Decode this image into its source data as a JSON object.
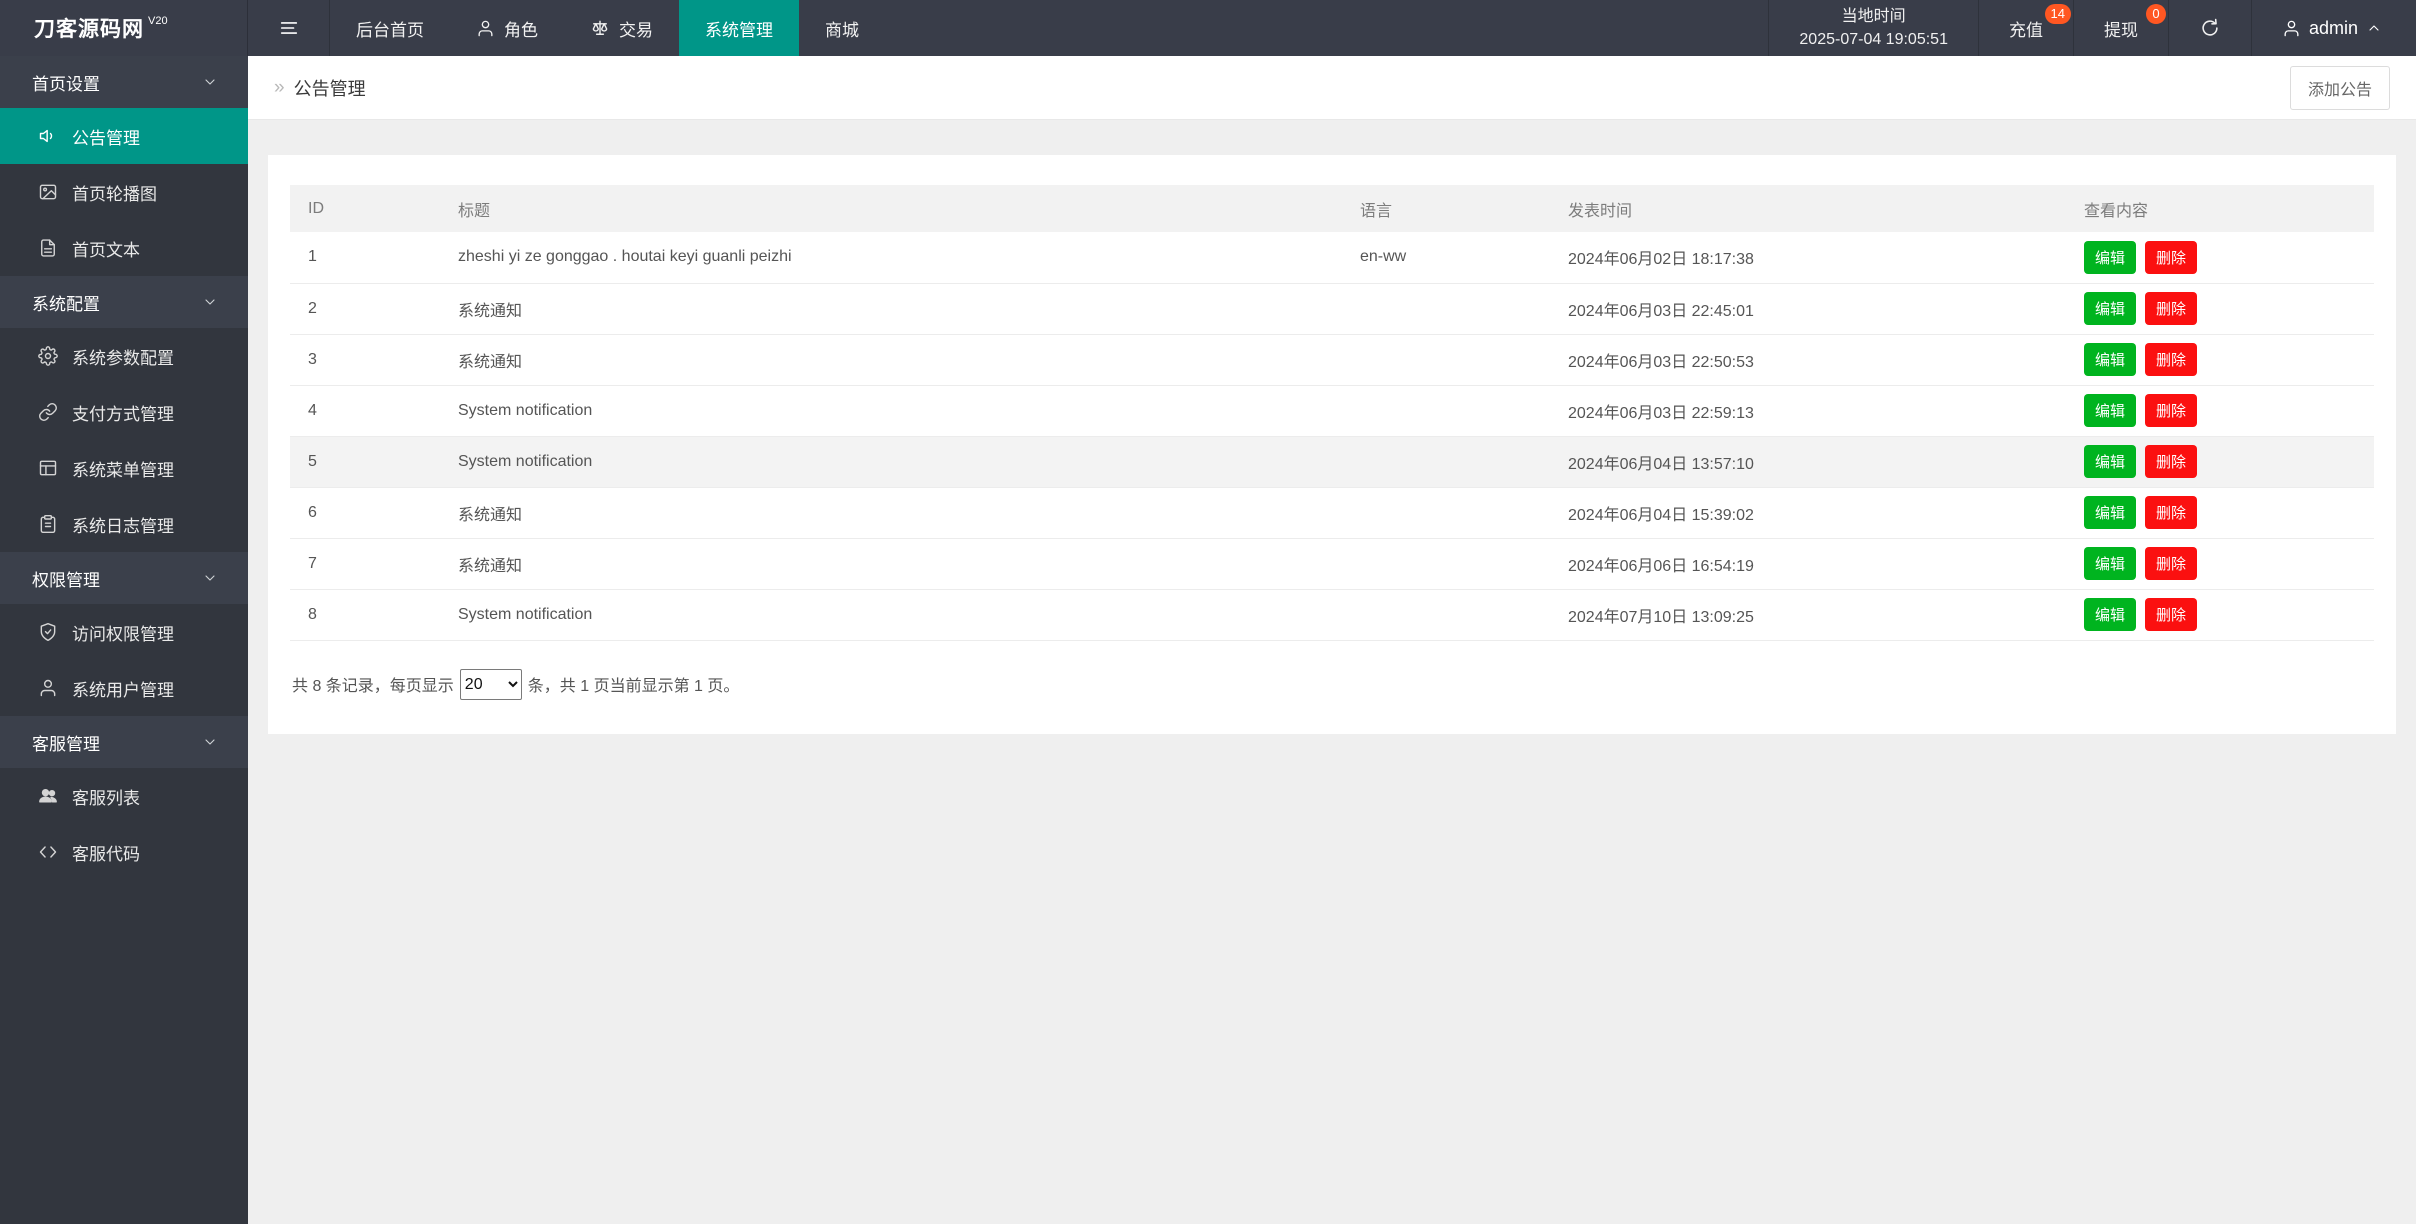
{
  "navbar": {
    "logo": "刀客源码网",
    "version": "V20",
    "items": [
      {
        "label": "后台首页"
      },
      {
        "label": "角色"
      },
      {
        "label": "交易"
      },
      {
        "label": "系统管理"
      },
      {
        "label": "商城"
      }
    ],
    "clock": {
      "label": "当地时间",
      "time": "2025-07-04 19:05:51"
    },
    "recharge": {
      "label": "充值",
      "badge": "14"
    },
    "withdraw": {
      "label": "提现",
      "badge": "0"
    },
    "username": "admin"
  },
  "sidebar": {
    "sections": [
      {
        "title": "首页设置",
        "items": [
          {
            "label": "公告管理"
          },
          {
            "label": "首页轮播图"
          },
          {
            "label": "首页文本"
          }
        ]
      },
      {
        "title": "系统配置",
        "items": [
          {
            "label": "系统参数配置"
          },
          {
            "label": "支付方式管理"
          },
          {
            "label": "系统菜单管理"
          },
          {
            "label": "系统日志管理"
          }
        ]
      },
      {
        "title": "权限管理",
        "items": [
          {
            "label": "访问权限管理"
          },
          {
            "label": "系统用户管理"
          }
        ]
      },
      {
        "title": "客服管理",
        "items": [
          {
            "label": "客服列表"
          },
          {
            "label": "客服代码"
          }
        ]
      }
    ]
  },
  "breadcrumb": {
    "separator": "»",
    "title": "公告管理"
  },
  "toolbar": {
    "add_label": "添加公告"
  },
  "table": {
    "headers": [
      "ID",
      "标题",
      "语言",
      "发表时间",
      "查看内容"
    ],
    "edit_label": "编辑",
    "delete_label": "删除",
    "rows": [
      {
        "id": "1",
        "title": "zheshi yi ze gonggao . houtai keyi guanli peizhi",
        "lang": "en-ww",
        "time": "2024年06月02日 18:17:38"
      },
      {
        "id": "2",
        "title": "系统通知",
        "lang": "",
        "time": "2024年06月03日 22:45:01"
      },
      {
        "id": "3",
        "title": "系统通知",
        "lang": "",
        "time": "2024年06月03日 22:50:53"
      },
      {
        "id": "4",
        "title": "System notification",
        "lang": "",
        "time": "2024年06月03日 22:59:13"
      },
      {
        "id": "5",
        "title": "System notification",
        "lang": "",
        "time": "2024年06月04日 13:57:10"
      },
      {
        "id": "6",
        "title": "系统通知",
        "lang": "",
        "time": "2024年06月04日 15:39:02"
      },
      {
        "id": "7",
        "title": "系统通知",
        "lang": "",
        "time": "2024年06月06日 16:54:19"
      },
      {
        "id": "8",
        "title": "System notification",
        "lang": "",
        "time": "2024年07月10日 13:09:25"
      }
    ]
  },
  "pagination": {
    "prefix": "共 8 条记录，每页显示",
    "page_size": "20",
    "suffix": "条，共 1 页当前显示第 1 页。"
  },
  "colors": {
    "accent_teal": "#009688",
    "navbar_bg": "#393d49",
    "sidebar_bg": "#32363e",
    "badge_orange": "#ff5722",
    "edit_green": "#00b41f",
    "delete_red": "#fb1010"
  }
}
